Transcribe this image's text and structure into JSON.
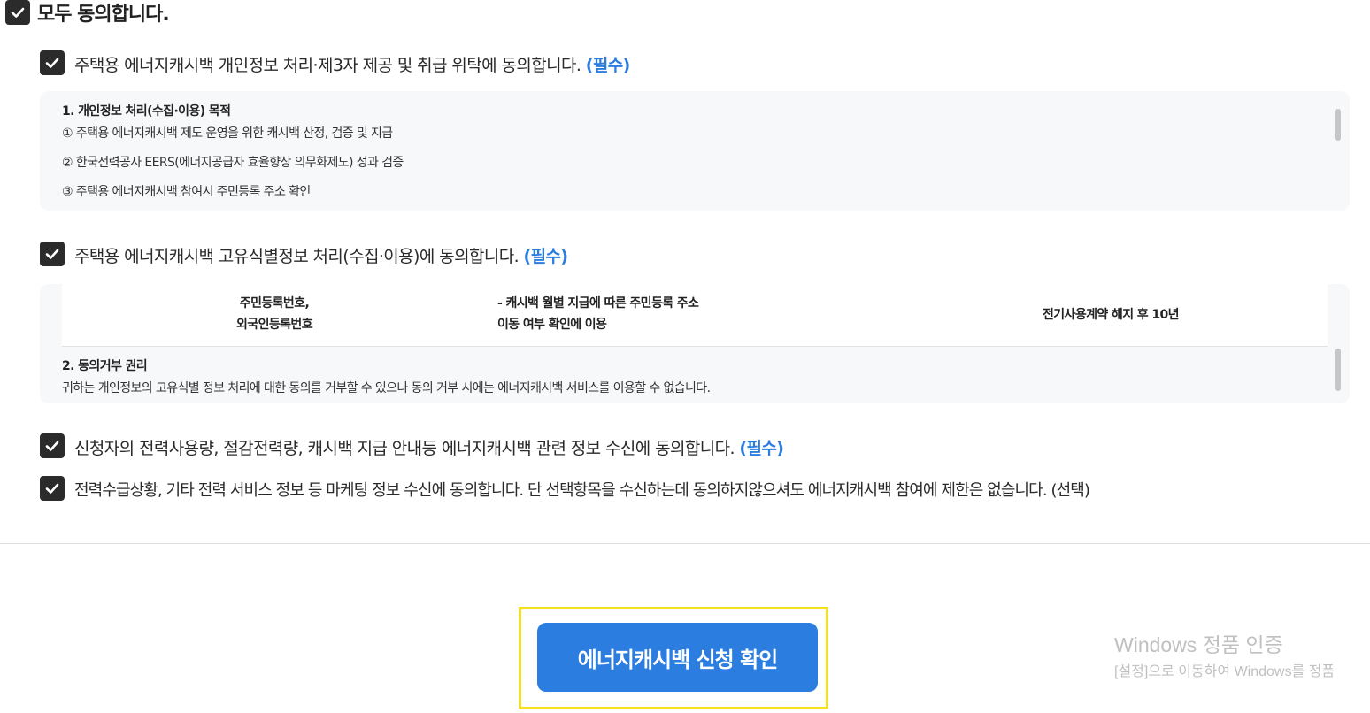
{
  "agree_all": {
    "label": "모두 동의합니다.",
    "checked": true
  },
  "items": [
    {
      "label": "주택용 에너지캐시백 개인정보 처리·제3자 제공 및 취급 위탁에 동의합니다.",
      "tag": "(필수)",
      "checked": true
    },
    {
      "label": "주택용 에너지캐시백 고유식별정보 처리(수집·이용)에 동의합니다.",
      "tag": "(필수)",
      "checked": true
    },
    {
      "label": "신청자의 전력사용량, 절감전력량, 캐시백 지급 안내등 에너지캐시백 관련 정보 수신에 동의합니다.",
      "tag": "(필수)",
      "checked": true
    },
    {
      "label": "전력수급상황, 기타 전력 서비스 정보 등 마케팅 정보 수신에 동의합니다. 단 선택항목을 수신하는데 동의하지않으셔도 에너지캐시백 참여에 제한은 없습니다. (선택)",
      "tag": "",
      "checked": true
    }
  ],
  "privacy_box": {
    "title": "1. 개인정보 처리(수집·이용) 목적",
    "lines": [
      "① 주택용 에너지캐시백 제도 운영을 위한 캐시백 산정, 검증 및 지급",
      "② 한국전력공사 EERS(에너지공급자 효율향상 의무화제도) 성과 검증",
      "③ 주택용 에너지캐시백 참여시 주민등록 주소 확인"
    ]
  },
  "unique_id_box": {
    "table_row": {
      "item_line1": "주민등록번호,",
      "item_line2": "외국인등록번호",
      "purpose_line1": "- 캐시백 월별 지급에 따른 주민등록 주소",
      "purpose_line2": "이동 여부 확인에 이용",
      "retention": "전기사용계약 해지 후 10년"
    },
    "section_title": "2. 동의거부 권리",
    "section_text": "귀하는 개인정보의 고유식별 정보 처리에 대한 동의를 거부할 수 있으나 동의 거부 시에는 에너지캐시백 서비스를 이용할 수 없습니다."
  },
  "submit_button": {
    "label": "에너지캐시백 신청 확인"
  },
  "windows_watermark": {
    "line1": "Windows 정품 인증",
    "line2": "[설정]으로 이동하여 Windows를 정품"
  },
  "colors": {
    "accent": "#2b7de0",
    "checkbox": "#2b2b2b",
    "highlight": "#f3e21b"
  }
}
